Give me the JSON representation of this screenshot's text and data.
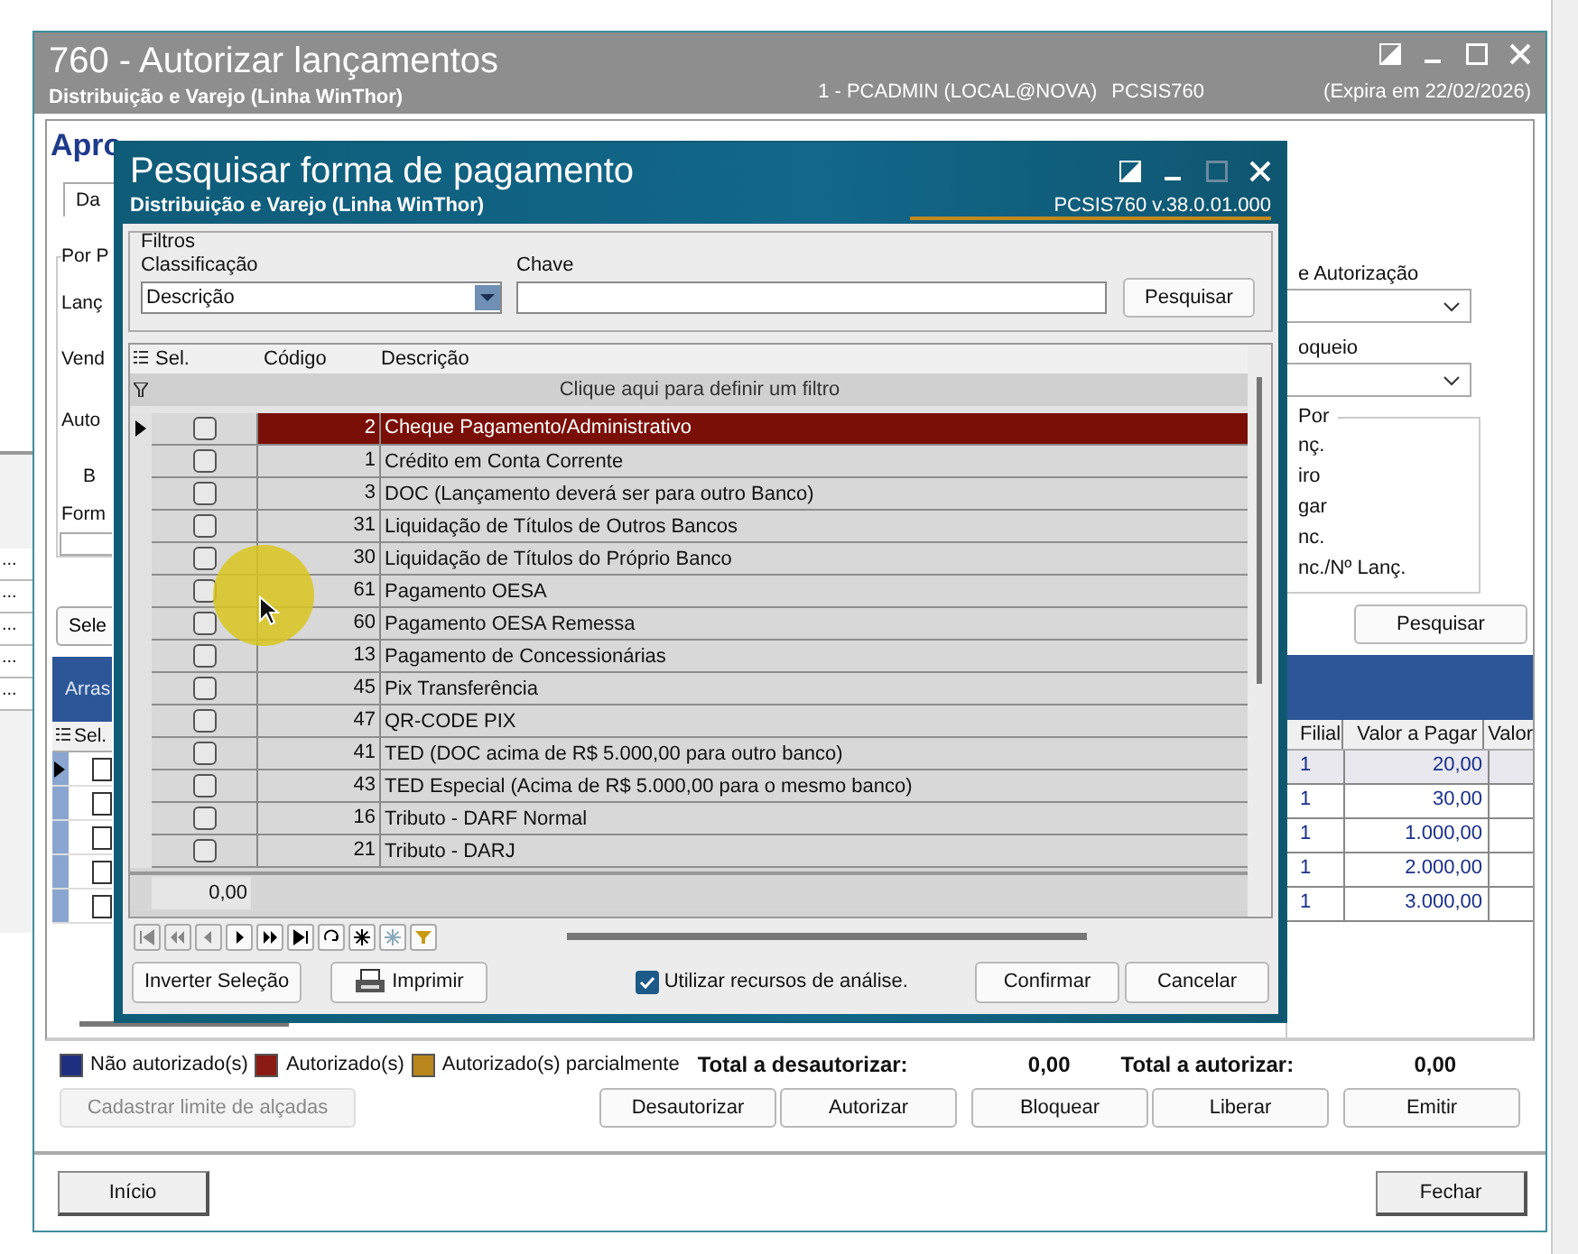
{
  "window": {
    "title": "760 - Autorizar lançamentos",
    "subtitle": "Distribuição e Varejo (Linha WinThor)",
    "user": "1 - PCADMIN (LOCAL@NOVA)",
    "program": "PCSIS760",
    "expiry": "(Expira em 22/02/2026)"
  },
  "side_ellipsis": [
    "...",
    "...",
    "...",
    "...",
    "..."
  ],
  "main": {
    "heading": "Apro",
    "tab": "Da",
    "group_title": "Por P",
    "left_labels": [
      "Lanç",
      "Vend",
      "Auto",
      "B",
      "Form"
    ],
    "left_button": "Sele",
    "band_label": "Arras",
    "grid_sel": "Sel.",
    "right_label_1": "e Autorização",
    "right_label_2": "oqueio",
    "right_group_title": "Por",
    "right_group_items": [
      "nç.",
      "iro",
      "gar",
      "nc.",
      "nc./Nº Lanç."
    ],
    "search_button": "Pesquisar",
    "grid_columns": [
      "Filial",
      "Valor a Pagar",
      "Valor"
    ],
    "grid_rows": [
      {
        "filial": "1",
        "value": "20,00",
        "checked": false,
        "current": true
      },
      {
        "filial": "1",
        "value": "30,00",
        "checked": false,
        "current": false
      },
      {
        "filial": "1",
        "value": "1.000,00",
        "checked": false,
        "current": false
      },
      {
        "filial": "1",
        "value": "2.000,00",
        "checked": false,
        "current": false
      },
      {
        "filial": "1",
        "value": "3.000,00",
        "checked": false,
        "current": false
      }
    ]
  },
  "legend": [
    {
      "label": "Não autorizado(s)",
      "color": "#1f2f80"
    },
    {
      "label": "Autorizado(s)",
      "color": "#8c1a14"
    },
    {
      "label": "Autorizado(s) parcialmente",
      "color": "#b8861c"
    }
  ],
  "totals": [
    {
      "label": "Total a desautorizar:",
      "value": "0,00"
    },
    {
      "label": "Total a autorizar:",
      "value": "0,00"
    }
  ],
  "limit_button": {
    "label": "Cadastrar limite de alçadas",
    "disabled": true
  },
  "actions": [
    "Desautorizar",
    "Autorizar",
    "Bloquear",
    "Liberar",
    "Emitir"
  ],
  "footer": {
    "left": "Início",
    "right": "Fechar"
  },
  "dialog": {
    "title": "Pesquisar forma de pagamento",
    "subtitle": "Distribuição e Varejo (Linha WinThor)",
    "version": "PCSIS760  v.38.0.01.000",
    "filters": {
      "legend": "Filtros",
      "class_label": "Classificação",
      "class_value": "Descrição",
      "key_label": "Chave",
      "search_button": "Pesquisar"
    },
    "columns": [
      "Sel.",
      "Código",
      "Descrição"
    ],
    "filter_hint": "Clique aqui para definir um filtro",
    "rows": [
      {
        "code": "2",
        "description": "Cheque Pagamento/Administrativo",
        "checked": false,
        "selected": true
      },
      {
        "code": "1",
        "description": "Crédito em Conta Corrente",
        "checked": false,
        "selected": false
      },
      {
        "code": "3",
        "description": "DOC (Lançamento deverá ser para outro Banco)",
        "checked": false,
        "selected": false
      },
      {
        "code": "31",
        "description": "Liquidação de Títulos de Outros Bancos",
        "checked": false,
        "selected": false
      },
      {
        "code": "30",
        "description": "Liquidação de Títulos do Próprio Banco",
        "checked": false,
        "selected": false
      },
      {
        "code": "61",
        "description": "Pagamento OESA",
        "checked": false,
        "selected": false
      },
      {
        "code": "60",
        "description": "Pagamento OESA Remessa",
        "checked": false,
        "selected": false
      },
      {
        "code": "13",
        "description": "Pagamento de Concessionárias",
        "checked": false,
        "selected": false
      },
      {
        "code": "45",
        "description": "Pix Transferência",
        "checked": false,
        "selected": false
      },
      {
        "code": "47",
        "description": "QR-CODE PIX",
        "checked": false,
        "selected": false
      },
      {
        "code": "41",
        "description": "TED (DOC acima de R$ 5.000,00 para outro banco)",
        "checked": false,
        "selected": false
      },
      {
        "code": "43",
        "description": "TED Especial (Acima de R$ 5.000,00 para o mesmo banco)",
        "checked": false,
        "selected": false
      },
      {
        "code": "16",
        "description": "Tributo - DARF Normal",
        "checked": false,
        "selected": false
      },
      {
        "code": "21",
        "description": "Tributo - DARJ",
        "checked": false,
        "selected": false
      }
    ],
    "sum": "0,00",
    "invert_button": "Inverter Seleção",
    "print_button": "Imprimir",
    "analysis": {
      "label": "Utilizar recursos de análise.",
      "checked": true
    },
    "confirm_button": "Confirmar",
    "cancel_button": "Cancelar"
  }
}
